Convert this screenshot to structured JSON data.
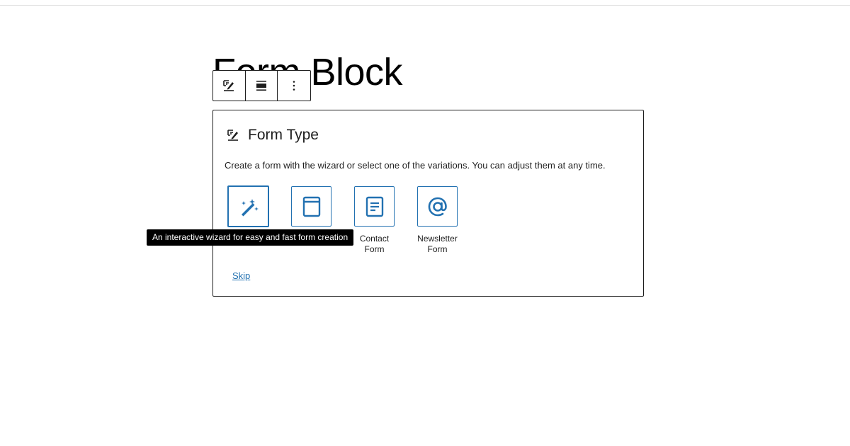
{
  "page": {
    "title": "Form Block"
  },
  "toolbar": {
    "items": [
      {
        "icon": "form-edit-icon"
      },
      {
        "icon": "align-icon"
      },
      {
        "icon": "more-options-icon"
      }
    ]
  },
  "placeholder": {
    "title": "Form Type",
    "instructions": "Create a form with the wizard or select one of the variations. You can adjust them at any time.",
    "variations": [
      {
        "icon": "magic-wand-icon",
        "label": ""
      },
      {
        "icon": "blank-form-icon",
        "label": ""
      },
      {
        "icon": "contact-form-icon",
        "label": "Contact\nForm"
      },
      {
        "icon": "at-sign-icon",
        "label": "Newsletter\nForm"
      }
    ],
    "skip_label": "Skip"
  },
  "tooltip": {
    "text": "An interactive wizard for easy and fast form creation"
  },
  "colors": {
    "accent": "#2271b1",
    "border": "#1e1e1e",
    "tooltip_bg": "#000000"
  }
}
